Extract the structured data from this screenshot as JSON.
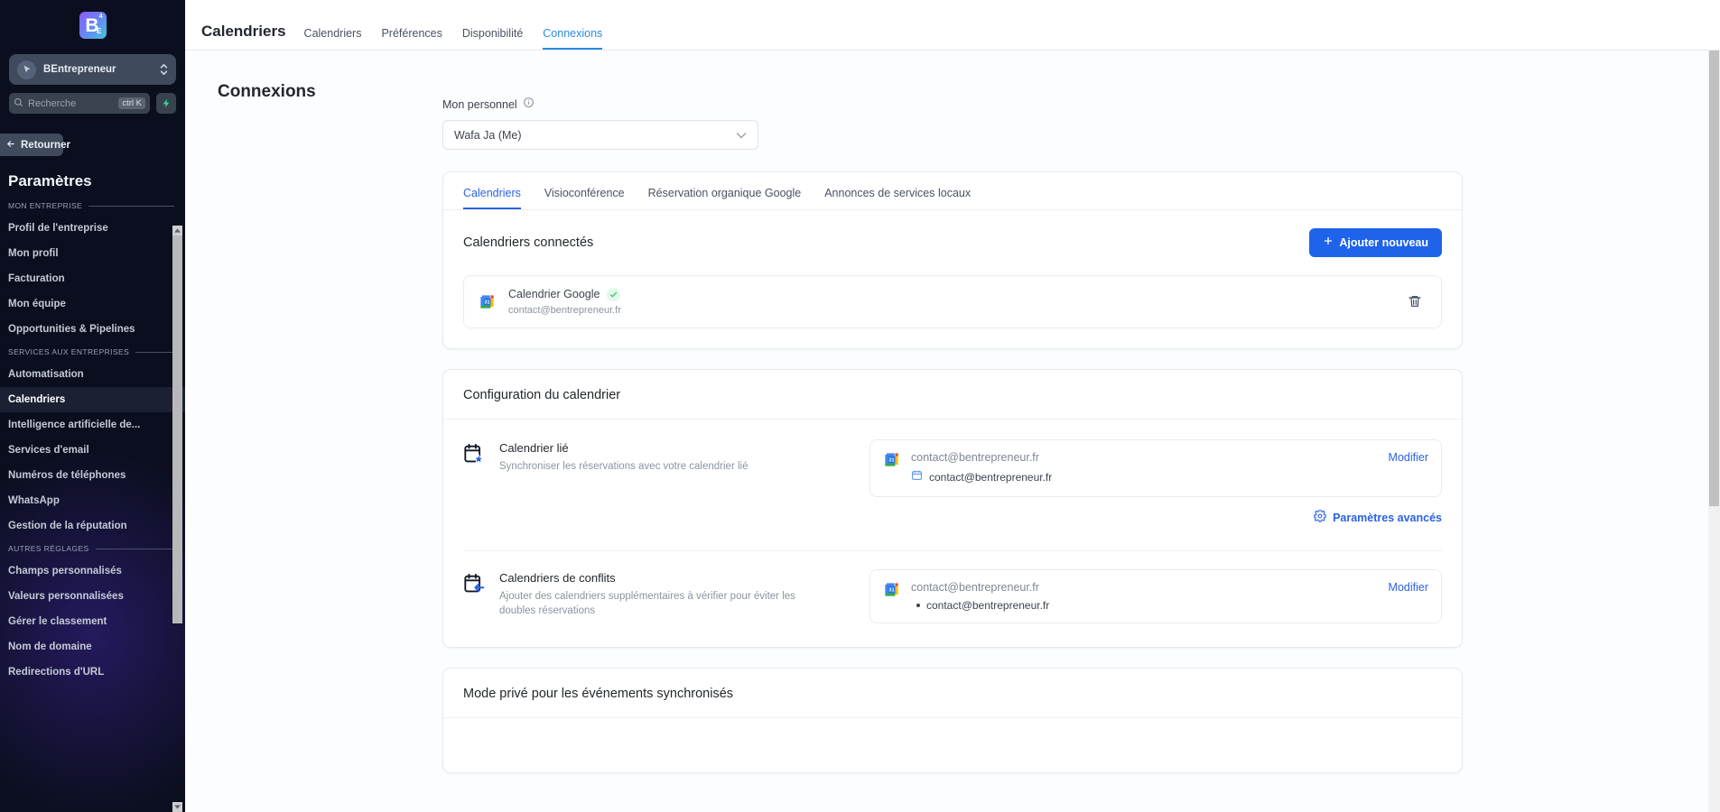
{
  "sidebar": {
    "logo": {
      "letter": "B",
      "sub": "E",
      "sup": "4",
      "icon": "brand-logo"
    },
    "org": {
      "name": "BEntrepreneur",
      "avatar_icon": "cursor-click-icon",
      "switch_icon": "up-down-chevrons-icon"
    },
    "search": {
      "placeholder": "Recherche",
      "shortcut": "ctrl K",
      "icon": "search-icon",
      "spark_icon": "lightning-bolt-icon"
    },
    "back_button": {
      "label": "Retourner",
      "icon": "arrow-left-icon"
    },
    "title": "Paramètres",
    "groups": [
      {
        "label": "MON ENTREPRISE",
        "items": [
          {
            "label": "Profil de l'entreprise",
            "active": false
          },
          {
            "label": "Mon profil",
            "active": false
          },
          {
            "label": "Facturation",
            "active": false
          },
          {
            "label": "Mon équipe",
            "active": false
          },
          {
            "label": "Opportunities & Pipelines",
            "active": false
          }
        ]
      },
      {
        "label": "SERVICES AUX ENTREPRISES",
        "items": [
          {
            "label": "Automatisation",
            "active": false
          },
          {
            "label": "Calendriers",
            "active": true
          },
          {
            "label": "Intelligence artificielle de...",
            "active": false
          },
          {
            "label": "Services d'email",
            "active": false
          },
          {
            "label": "Numéros de téléphones",
            "active": false
          },
          {
            "label": "WhatsApp",
            "active": false
          },
          {
            "label": "Gestion de la réputation",
            "active": false
          }
        ]
      },
      {
        "label": "AUTRES RÉGLAGES",
        "items": [
          {
            "label": "Champs personnalisés",
            "active": false
          },
          {
            "label": "Valeurs personnalisées",
            "active": false
          },
          {
            "label": "Gérer le classement",
            "active": false
          },
          {
            "label": "Nom de domaine",
            "active": false
          },
          {
            "label": "Redirections d'URL",
            "active": false
          }
        ]
      }
    ]
  },
  "topbar": {
    "title": "Calendriers",
    "tabs": [
      {
        "label": "Calendriers",
        "active": false
      },
      {
        "label": "Préférences",
        "active": false
      },
      {
        "label": "Disponibilité",
        "active": false
      },
      {
        "label": "Connexions",
        "active": true
      }
    ]
  },
  "page": {
    "title": "Connexions",
    "personnel": {
      "label": "Mon personnel",
      "info_icon": "info-circle-icon",
      "selected": "Wafa Ja (Me)",
      "chevron_icon": "chevron-down-icon"
    }
  },
  "connections_card": {
    "tabs": [
      {
        "label": "Calendriers",
        "active": true
      },
      {
        "label": "Visioconférence",
        "active": false
      },
      {
        "label": "Réservation organique Google",
        "active": false
      },
      {
        "label": "Annonces de services locaux",
        "active": false
      }
    ],
    "section_title": "Calendriers connectés",
    "add_button": {
      "label": "Ajouter nouveau",
      "icon": "plus-icon"
    },
    "connection": {
      "icon": "google-calendar-icon",
      "name": "Calendrier Google",
      "status_icon": "check-icon",
      "email": "contact@bentrepreneur.fr",
      "delete_icon": "trash-icon"
    }
  },
  "config_card": {
    "title": "Configuration du calendrier",
    "rows": [
      {
        "icon": "calendar-star-icon",
        "name": "Calendrier lié",
        "desc": "Synchroniser les réservations avec votre calendrier lié",
        "account_icon": "google-calendar-icon",
        "account_email": "contact@bentrepreneur.fr",
        "sub_icon": "calendar-outline-icon",
        "sub_email": "contact@bentrepreneur.fr",
        "edit_label": "Modifier",
        "advanced": {
          "label": "Paramètres avancés",
          "icon": "gear-icon"
        }
      },
      {
        "icon": "calendar-arrow-left-icon",
        "name": "Calendriers de conflits",
        "desc": "Ajouter des calendriers supplémentaires à vérifier pour éviter les doubles réservations",
        "account_icon": "google-calendar-icon",
        "account_email": "contact@bentrepreneur.fr",
        "sub_icon": "bullet-dot-icon",
        "sub_email": "contact@bentrepreneur.fr",
        "edit_label": "Modifier"
      }
    ]
  },
  "privacy_card": {
    "title": "Mode privé pour les événements synchronisés"
  },
  "colors": {
    "sidebar_bg": "#0b0e1e",
    "accent_blue": "#1e63e9",
    "tab_blue": "#2a8ae0",
    "link_blue": "#2a62e0"
  }
}
